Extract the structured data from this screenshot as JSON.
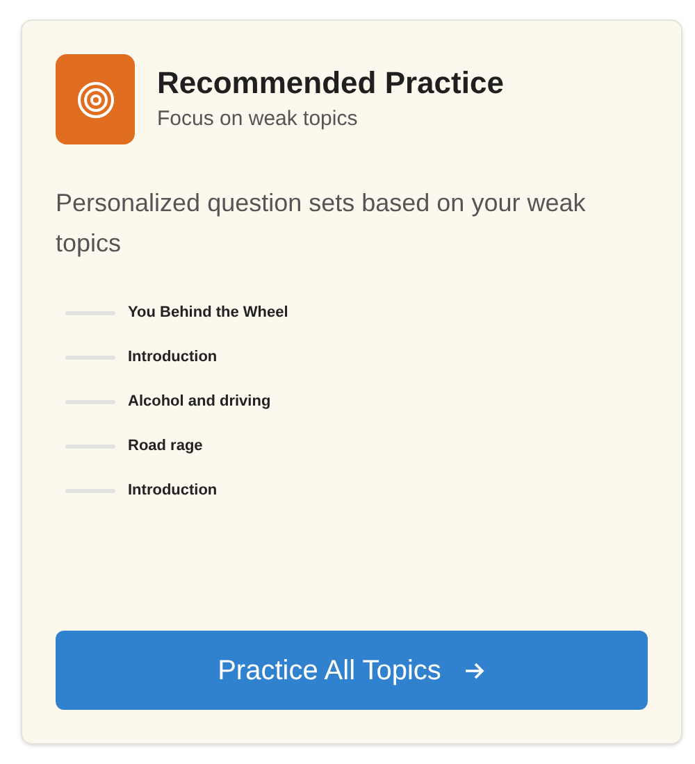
{
  "card": {
    "title": "Recommended Practice",
    "subtitle": "Focus on weak topics",
    "description": "Personalized question sets based on your weak topics",
    "topics": [
      {
        "label": "You Behind the Wheel",
        "level": 0
      },
      {
        "label": "Introduction",
        "level": 0
      },
      {
        "label": "Alcohol and driving",
        "level": 0
      },
      {
        "label": "Road rage",
        "level": 0
      },
      {
        "label": "Introduction",
        "level": 0
      }
    ],
    "button": {
      "label": "Practice All Topics"
    }
  }
}
